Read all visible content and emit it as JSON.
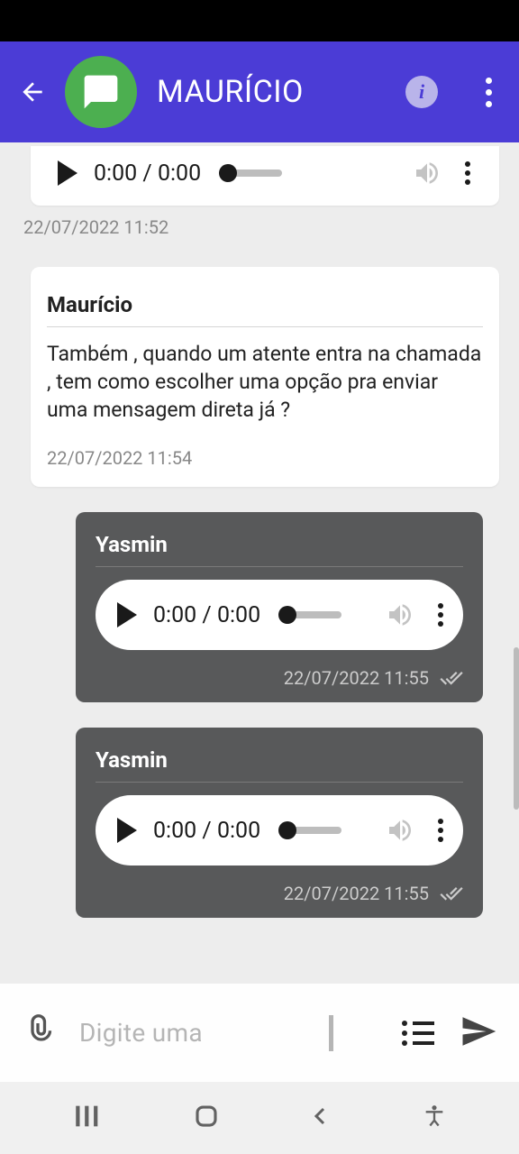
{
  "header": {
    "title": "MAURÍCIO"
  },
  "messages": [
    {
      "kind": "audio_incoming_partial",
      "current": "0:00",
      "total": "0:00",
      "timestamp": "22/07/2022 11:52"
    },
    {
      "kind": "text_incoming",
      "sender": "Maurício",
      "body": "Também , quando um atente entra na chamada , tem como escolher uma opção pra enviar uma mensagem direta já ?",
      "timestamp": "22/07/2022 11:54"
    },
    {
      "kind": "audio_outgoing",
      "sender": "Yasmin",
      "current": "0:00",
      "total": "0:00",
      "timestamp": "22/07/2022 11:55"
    },
    {
      "kind": "audio_outgoing",
      "sender": "Yasmin",
      "current": "0:00",
      "total": "0:00",
      "timestamp": "22/07/2022 11:55"
    }
  ],
  "input": {
    "placeholder": "Digite uma"
  }
}
